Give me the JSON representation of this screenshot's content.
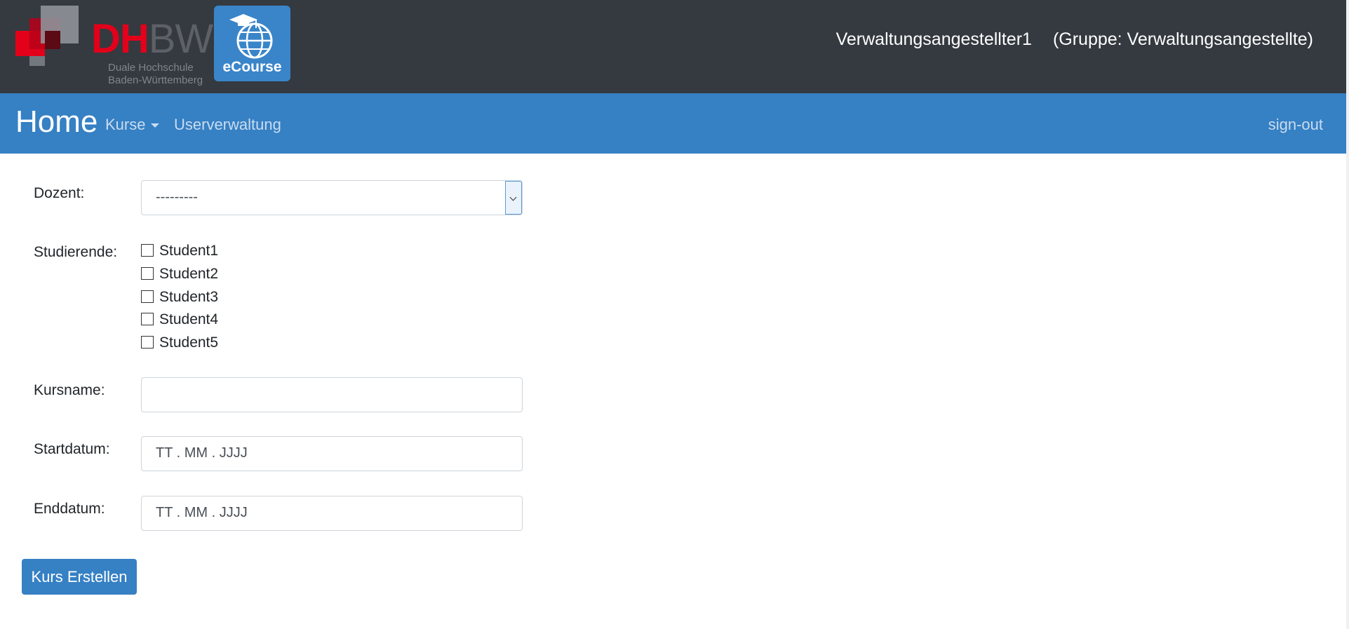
{
  "header": {
    "logo_primary": "DH",
    "logo_secondary": "BW",
    "logo_subtitle_1": "Duale Hochschule",
    "logo_subtitle_2": "Baden-Württemberg",
    "app_logo_label": "eCourse",
    "user_name": "Verwaltungsangestellter1",
    "user_group": "(Gruppe: Verwaltungsangestellte)"
  },
  "nav": {
    "brand": "Home",
    "items": [
      {
        "label": "Kurse",
        "icon": "caret-down-icon"
      },
      {
        "label": "Userverwaltung"
      }
    ],
    "signout": "sign-out"
  },
  "form": {
    "dozent": {
      "label": "Dozent:",
      "value": "---------"
    },
    "studierende": {
      "label": "Studierende:",
      "options": [
        {
          "label": "Student1",
          "checked": false
        },
        {
          "label": "Student2",
          "checked": false
        },
        {
          "label": "Student3",
          "checked": false
        },
        {
          "label": "Student4",
          "checked": false
        },
        {
          "label": "Student5",
          "checked": false
        }
      ]
    },
    "kursname": {
      "label": "Kursname:",
      "value": ""
    },
    "startdatum": {
      "label": "Startdatum:",
      "placeholder": "TT . MM . JJJJ"
    },
    "enddatum": {
      "label": "Enddatum:",
      "placeholder": "TT . MM . JJJJ"
    },
    "submit_label": "Kurs Erstellen"
  },
  "colors": {
    "header_bg": "#343a40",
    "nav_bg": "#3680c4",
    "brand_red": "#e2001a",
    "button_bg": "#3680c4"
  }
}
